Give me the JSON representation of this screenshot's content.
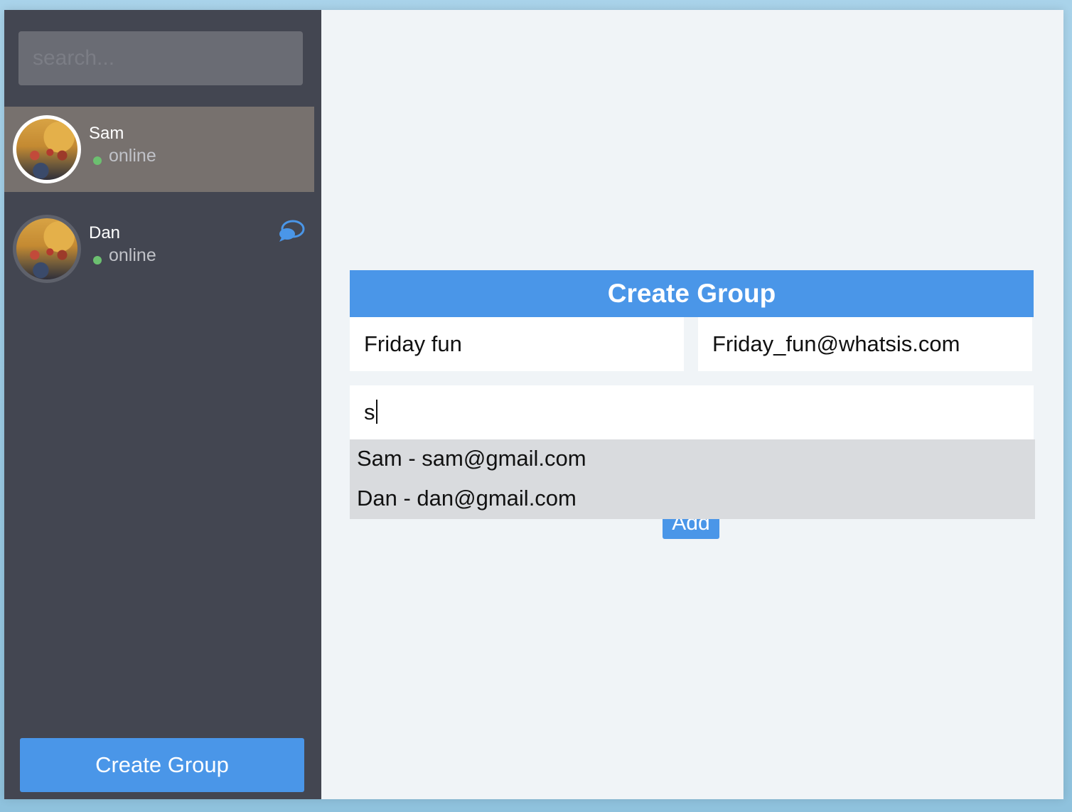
{
  "sidebar": {
    "search_placeholder": "search...",
    "contacts": [
      {
        "name": "Sam",
        "status": "online",
        "active": true
      },
      {
        "name": "Dan",
        "status": "online",
        "active": false
      }
    ],
    "create_group_label": "Create Group"
  },
  "form": {
    "title": "Create Group",
    "group_name_value": "Friday fun",
    "group_email_value": "Friday_fun@whatsis.com",
    "member_input_value": "s",
    "add_label": "Add",
    "suggestions": [
      "Sam - sam@gmail.com",
      "Dan - dan@gmail.com"
    ]
  },
  "colors": {
    "accent": "#4a96e8",
    "sidebar_bg": "#434651",
    "active_contact_bg": "#77716e",
    "online": "#6cc070"
  },
  "icons": {
    "chat": "chat-bubbles-icon"
  }
}
